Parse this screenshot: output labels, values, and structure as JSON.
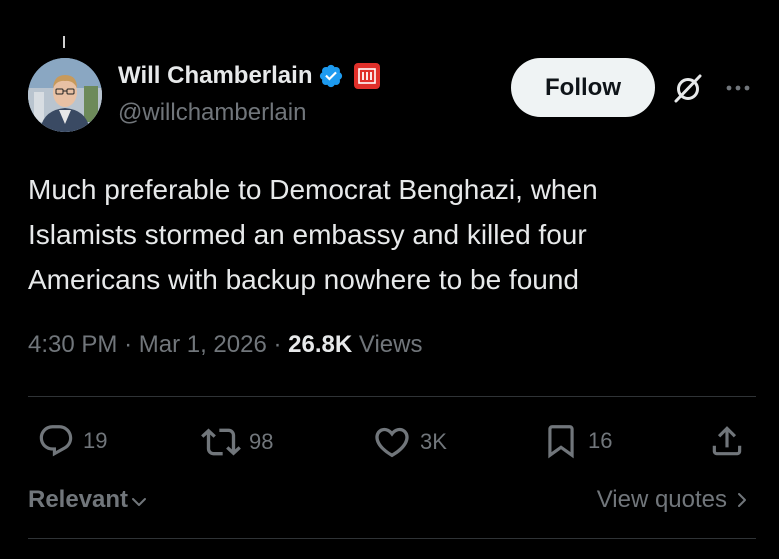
{
  "author": {
    "display_name": "Will Chamberlain",
    "handle": "@willchamberlain",
    "verified": true
  },
  "follow_button": {
    "label": "Follow"
  },
  "tweet": {
    "text_lines": [
      "Much preferable to Democrat Benghazi, when",
      "Islamists stormed an embassy and killed four",
      "Americans with backup nowhere to be found"
    ],
    "time": "4:30 PM",
    "separator": "·",
    "date": "Mar 1, 2026",
    "views_count": "26.8K",
    "views_label": "Views"
  },
  "actions": {
    "replies": "19",
    "reposts": "98",
    "likes": "3K",
    "bookmarks": "16"
  },
  "footer": {
    "sort_label": "Relevant",
    "view_quotes_label": "View quotes"
  },
  "colors": {
    "background": "#000000",
    "text_primary": "#e7e9ea",
    "text_secondary": "#71767b",
    "verified_blue": "#1d9bf0",
    "badge_red": "#e0302a",
    "button_bg": "#eff3f4"
  },
  "icons": [
    "verified-badge-icon",
    "affiliation-badge-icon",
    "grok-icon",
    "more-icon",
    "reply-icon",
    "repost-icon",
    "like-icon",
    "bookmark-icon",
    "share-icon",
    "chevron-down-icon",
    "chevron-right-icon"
  ]
}
